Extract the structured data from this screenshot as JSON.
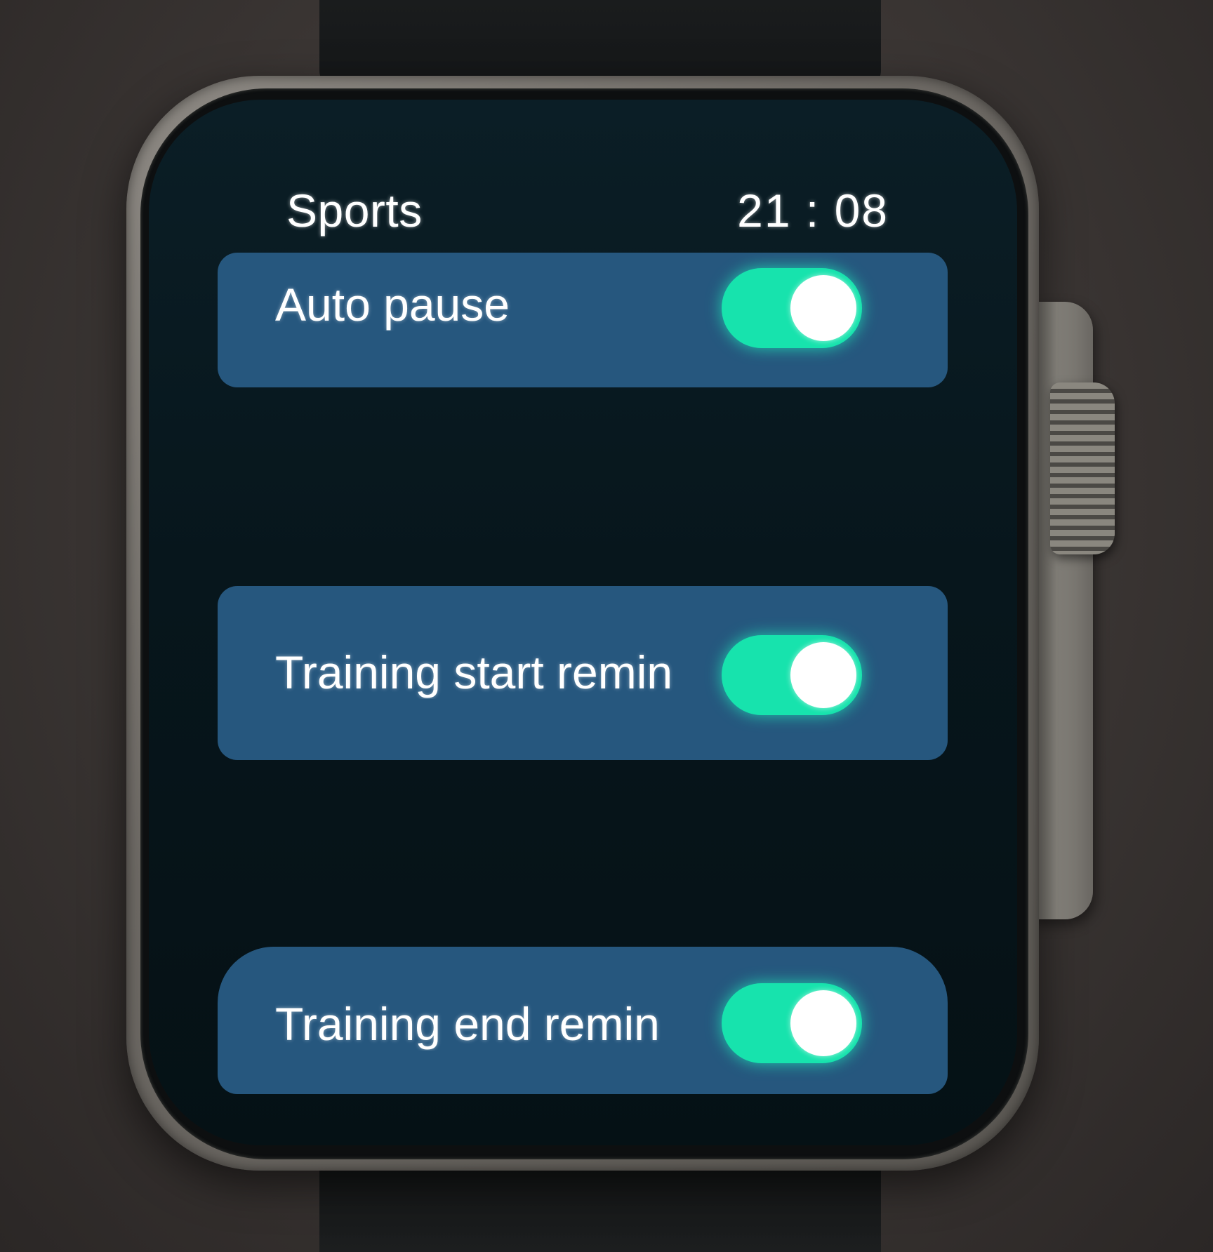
{
  "header": {
    "title": "Sports",
    "time": "21 : 08"
  },
  "settings": [
    {
      "label": "Auto pause",
      "enabled": true
    },
    {
      "label": "Training start remin",
      "enabled": true
    },
    {
      "label": "Training end remin",
      "enabled": true
    }
  ],
  "colors": {
    "card": "#26577e",
    "toggle_on": "#17e3ad",
    "screen_bg": "#07161c"
  }
}
